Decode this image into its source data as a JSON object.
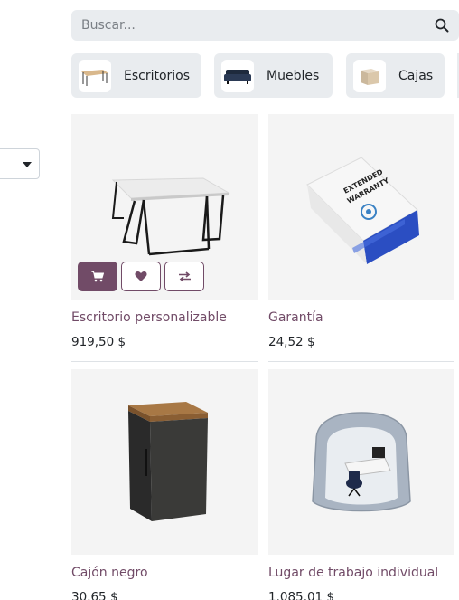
{
  "search": {
    "placeholder": "Buscar...",
    "icon": "search-icon"
  },
  "categories": [
    {
      "label": "Escritorios",
      "icon": "desk-thumbnail"
    },
    {
      "label": "Muebles",
      "icon": "sofa-thumbnail"
    },
    {
      "label": "Cajas",
      "icon": "box-thumbnail"
    }
  ],
  "products": [
    {
      "name": "Escritorio personalizable",
      "price": "919,50 $"
    },
    {
      "name": "Garantía",
      "price": "24,52 $",
      "image_text": [
        "EXTENDED",
        "WARRANTY"
      ]
    },
    {
      "name": "Cajón negro",
      "price": "30,65 $"
    },
    {
      "name": "Lugar de trabajo individual",
      "price": "1.085,01 $"
    }
  ],
  "card_actions": {
    "cart_icon": "cart-icon",
    "wishlist_icon": "heart-icon",
    "compare_icon": "compare-arrows-icon"
  },
  "colors": {
    "accent": "#714b67",
    "chip_bg": "#e9ecef",
    "image_bg": "#f4f4f4"
  }
}
